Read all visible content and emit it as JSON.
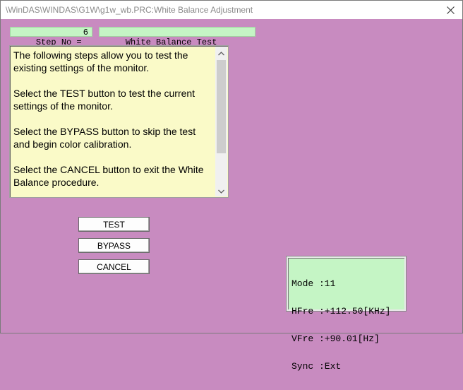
{
  "window": {
    "title": "\\WinDAS\\WINDAS\\G1W\\g1w_wb.PRC:White Balance Adjustment"
  },
  "step": {
    "label": "Step No =",
    "number": "6",
    "title": "White Balance Test"
  },
  "instructions": {
    "paragraphs": [
      "The following steps allow you to test the existing settings of the monitor.",
      "Select the TEST button to test the current settings of the monitor.",
      "Select the BYPASS button to skip the test and begin color calibration.",
      "Select the CANCEL button to exit the White Balance procedure."
    ]
  },
  "buttons": {
    "test": "TEST",
    "bypass": "BYPASS",
    "cancel": "CANCEL"
  },
  "mode_info": {
    "lines": [
      "Mode :11",
      "HFre :+112.50[KHz]",
      "VFre :+90.01[Hz]",
      "Sync :Ext"
    ]
  },
  "colors": {
    "background": "#c88bc0",
    "step_box": "#c5f5c5",
    "text_panel": "#fafac8",
    "info_panel": "#c5f5c5"
  },
  "icons": {
    "close": "close-icon",
    "scroll_up": "chevron-up-icon",
    "scroll_down": "chevron-down-icon"
  }
}
